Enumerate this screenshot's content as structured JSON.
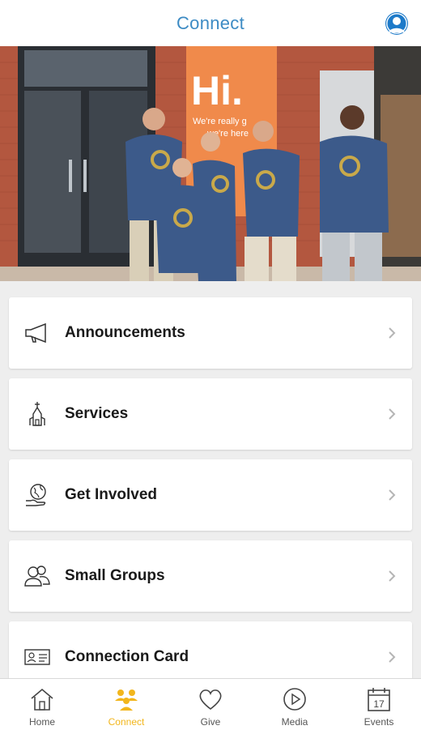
{
  "header": {
    "title": "Connect"
  },
  "hero": {
    "banner_big": "Hi.",
    "banner_line1": "We're really g",
    "banner_line2": "we're here"
  },
  "menu": {
    "items": [
      {
        "label": "Announcements",
        "icon": "megaphone-icon"
      },
      {
        "label": "Services",
        "icon": "church-icon"
      },
      {
        "label": "Get Involved",
        "icon": "globe-hand-icon"
      },
      {
        "label": "Small Groups",
        "icon": "people-icon"
      },
      {
        "label": "Connection Card",
        "icon": "id-card-icon"
      }
    ]
  },
  "tabbar": {
    "tabs": [
      {
        "label": "Home",
        "icon": "home-icon"
      },
      {
        "label": "Connect",
        "icon": "people-group-icon"
      },
      {
        "label": "Give",
        "icon": "heart-icon"
      },
      {
        "label": "Media",
        "icon": "play-icon"
      },
      {
        "label": "Events",
        "icon": "calendar-icon"
      }
    ],
    "calendar_day": "17",
    "active_index": 1
  },
  "colors": {
    "header_title": "#3d8bc4",
    "avatar": "#1d7ac9",
    "active_tab": "#f2b61c",
    "banner": "#f08a4b",
    "shirt": "#3c5a8a",
    "brick": "#b3573f"
  }
}
